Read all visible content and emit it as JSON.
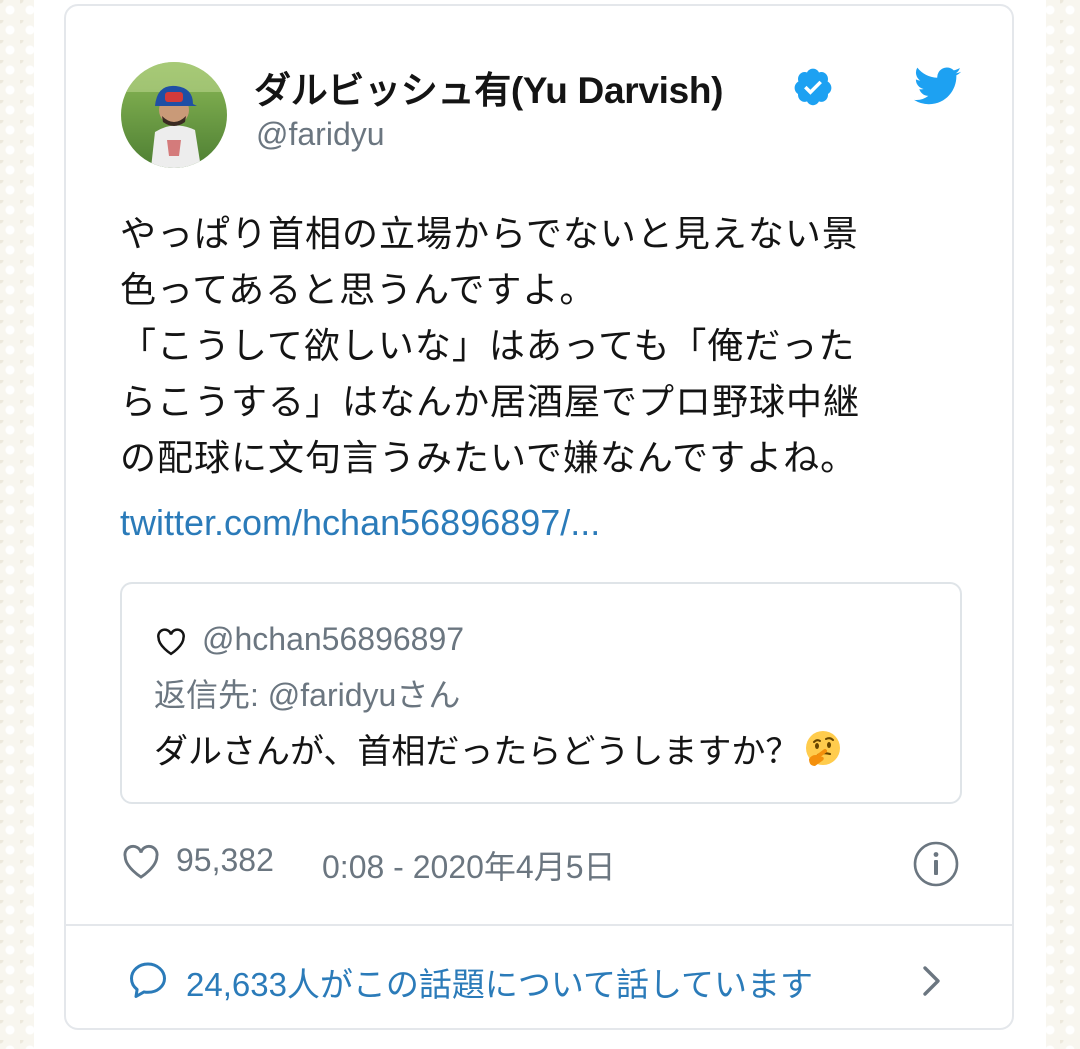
{
  "tweet": {
    "author": {
      "display_name": "ダルビッシュ有(Yu Darvish)",
      "screen_name": "@faridyu",
      "verified": true
    },
    "text_lines": [
      "やっぱり首相の立場からでないと見えない景",
      "色ってあると思うんですよ。",
      "「こうして欲しいな」はあっても「俺だった",
      "らこうする」はなんか居酒屋でプロ野球中継",
      "の配球に文句言うみたいで嫌なんですよね。"
    ],
    "link": "twitter.com/hchan56896897/...",
    "quoted": {
      "handle": "@hchan56896897",
      "reply_to": "返信先: @faridyuさん",
      "text": "ダルさんが、首相だったらどうしますか？",
      "emoji": "thinking-face"
    },
    "like_count": "95,382",
    "timestamp": "0:08 - 2020年4月5日",
    "conversation": "24,633人がこの話題について話しています"
  },
  "icons": {
    "brand": "twitter-bird-icon",
    "verified": "verified-badge-icon",
    "like": "heart-icon",
    "info": "info-icon",
    "conversation": "speech-bubble-icon",
    "more": "chevron-right-icon"
  },
  "colors": {
    "brand_blue": "#1da1f2",
    "link_blue": "#2b7bb9",
    "text": "#141414",
    "muted": "#6b7680",
    "border": "#e4e7eb"
  }
}
